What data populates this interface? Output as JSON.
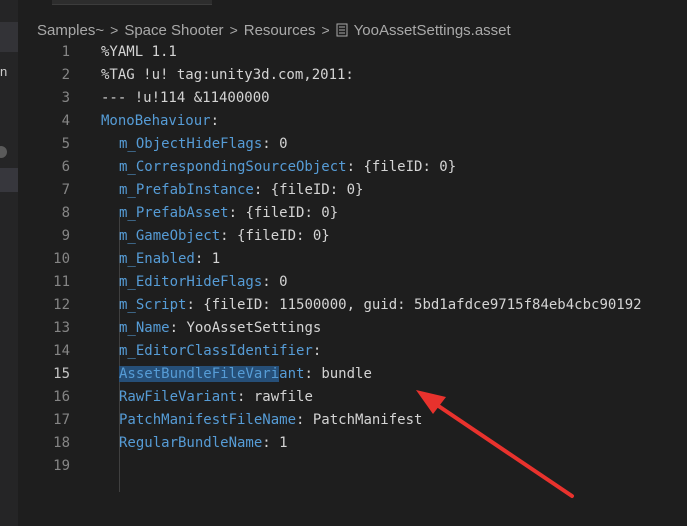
{
  "breadcrumb": {
    "items": [
      "Samples~",
      "Space Shooter",
      "Resources"
    ],
    "file": "YooAssetSettings.asset",
    "separator": ">"
  },
  "sidebar": {
    "letter": "n"
  },
  "editor": {
    "active_line": 15,
    "lines": [
      {
        "n": "1",
        "key": "%YAML 1.1",
        "sep": "",
        "val": ""
      },
      {
        "n": "2",
        "key": "%TAG !u! tag:unity3d.com,2011:",
        "sep": "",
        "val": ""
      },
      {
        "n": "3",
        "key": "--- !u!114 &11400000",
        "sep": "",
        "val": ""
      },
      {
        "n": "4",
        "key": "MonoBehaviour",
        "sep": ":",
        "val": ""
      },
      {
        "n": "5",
        "key": "m_ObjectHideFlags",
        "sep": ":",
        "val": " 0"
      },
      {
        "n": "6",
        "key": "m_CorrespondingSourceObject",
        "sep": ":",
        "val": " {fileID: 0}"
      },
      {
        "n": "7",
        "key": "m_PrefabInstance",
        "sep": ":",
        "val": " {fileID: 0}"
      },
      {
        "n": "8",
        "key": "m_PrefabAsset",
        "sep": ":",
        "val": " {fileID: 0}"
      },
      {
        "n": "9",
        "key": "m_GameObject",
        "sep": ":",
        "val": " {fileID: 0}"
      },
      {
        "n": "10",
        "key": "m_Enabled",
        "sep": ":",
        "val": " 1"
      },
      {
        "n": "11",
        "key": "m_EditorHideFlags",
        "sep": ":",
        "val": " 0"
      },
      {
        "n": "12",
        "key": "m_Script",
        "sep": ":",
        "val": " {fileID: 11500000, guid: 5bd1afdce9715f84eb4cbc90192"
      },
      {
        "n": "13",
        "key": "m_Name",
        "sep": ":",
        "val": " YooAssetSettings"
      },
      {
        "n": "14",
        "key": "m_EditorClassIdentifier",
        "sep": ":",
        "val": ""
      },
      {
        "n": "15",
        "key": "AssetBundleFileVariant",
        "sep": ":",
        "val": " bundle",
        "selected": "AssetBundleFileVari"
      },
      {
        "n": "16",
        "key": "RawFileVariant",
        "sep": ":",
        "val": " rawfile"
      },
      {
        "n": "17",
        "key": "PatchManifestFileName",
        "sep": ":",
        "val": " PatchManifest"
      },
      {
        "n": "18",
        "key": "RegularBundleName",
        "sep": ":",
        "val": " 1"
      },
      {
        "n": "19",
        "key": "",
        "sep": "",
        "val": ""
      }
    ]
  },
  "colors": {
    "background": "#1e1e1e",
    "line_number": "#858585",
    "key": "#569cd6",
    "value": "#d4d4d4",
    "selection": "#264f78",
    "annotation_arrow": "#e8322d"
  }
}
